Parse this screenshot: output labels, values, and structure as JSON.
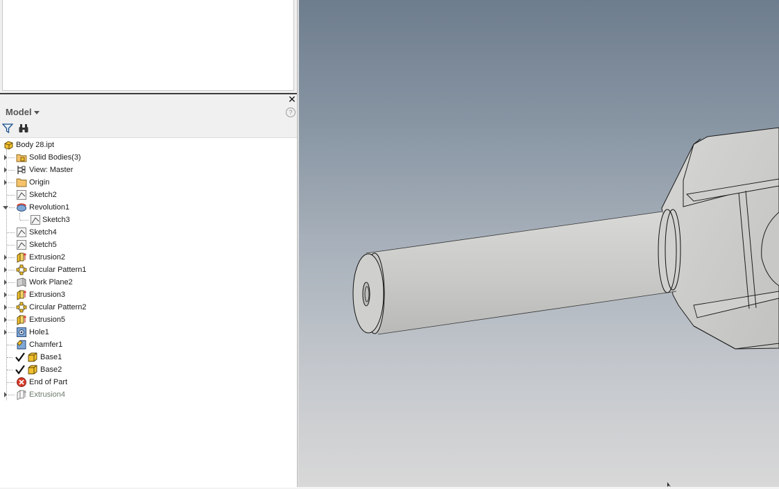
{
  "browser": {
    "title": "Model",
    "close_glyph": "✕",
    "help_glyph": "?",
    "filter_icon": "filter-icon",
    "search_icon": "binoculars-icon"
  },
  "tree": {
    "root": "Body 28.ipt",
    "items": [
      {
        "label": "Solid Bodies(3)",
        "icon": "solid-bodies-folder-icon",
        "expandable": true
      },
      {
        "label": "View: Master",
        "icon": "view-rep-icon",
        "expandable": true
      },
      {
        "label": "Origin",
        "icon": "folder-icon",
        "expandable": true
      },
      {
        "label": "Sketch2",
        "icon": "sketch-icon",
        "expandable": false
      },
      {
        "label": "Revolution1",
        "icon": "revolve-icon",
        "expandable": true,
        "expanded": true
      },
      {
        "label": "Sketch3",
        "icon": "sketch-icon",
        "child": true
      },
      {
        "label": "Sketch4",
        "icon": "sketch-icon",
        "expandable": false
      },
      {
        "label": "Sketch5",
        "icon": "sketch-icon",
        "expandable": false
      },
      {
        "label": "Extrusion2",
        "icon": "extrude-icon",
        "expandable": true
      },
      {
        "label": "Circular Pattern1",
        "icon": "circular-pattern-icon",
        "expandable": true
      },
      {
        "label": "Work Plane2",
        "icon": "work-plane-icon",
        "expandable": true
      },
      {
        "label": "Extrusion3",
        "icon": "extrude-icon",
        "expandable": true
      },
      {
        "label": "Circular Pattern2",
        "icon": "circular-pattern-icon",
        "expandable": true
      },
      {
        "label": "Extrusion5",
        "icon": "extrude-icon",
        "expandable": true
      },
      {
        "label": "Hole1",
        "icon": "hole-icon",
        "expandable": true
      },
      {
        "label": "Chamfer1",
        "icon": "chamfer-icon",
        "expandable": false
      },
      {
        "label": "Base1",
        "icon": "base-body-icon",
        "checked": true
      },
      {
        "label": "Base2",
        "icon": "base-body-icon",
        "checked": true
      },
      {
        "label": "End of Part",
        "icon": "end-of-part-icon",
        "expandable": false
      },
      {
        "label": "Extrusion4",
        "icon": "extrude-icon",
        "expandable": true,
        "suppressed": true
      }
    ]
  },
  "colors": {
    "folder": "#f5c26b",
    "extrude": "#f0c030",
    "end_of_part": "#d83a2a",
    "suppressed_text": "#6d7b6d"
  }
}
